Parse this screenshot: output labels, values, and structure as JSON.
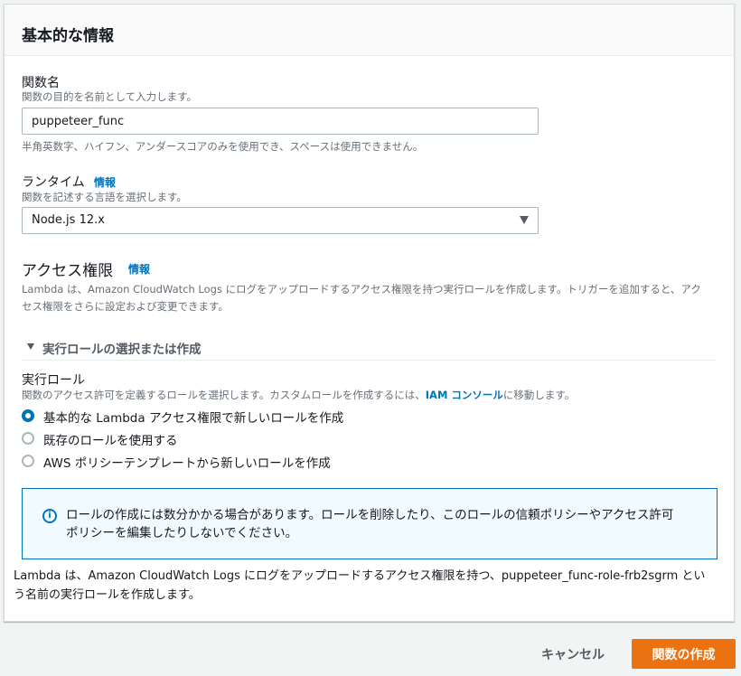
{
  "panel": {
    "title": "基本的な情報"
  },
  "function_name": {
    "label": "関数名",
    "description": "関数の目的を名前として入力します。",
    "value": "puppeteer_func",
    "hint": "半角英数字、ハイフン、アンダースコアのみを使用でき、スペースは使用できません。"
  },
  "runtime": {
    "label": "ランタイム",
    "info": "情報",
    "description": "関数を記述する言語を選択します。",
    "selected": "Node.js 12.x"
  },
  "permissions": {
    "title": "アクセス権限",
    "info": "情報",
    "description_line1": "Lambda は、Amazon CloudWatch Logs にログをアップロードするアクセス権限を持つ実行ロールを作成します。トリガーを追加すると、アク",
    "description_line2": "セス権限をさらに設定および変更できます。",
    "expander_label": "実行ロールの選択または作成"
  },
  "execution_role": {
    "label": "実行ロール",
    "description_before": "関数のアクセス許可を定義するロールを選択します。カスタムロールを作成するには、",
    "iam_link": "IAM コンソール",
    "description_after": "に移動します。",
    "options": [
      {
        "label": "基本的な Lambda アクセス権限で新しいロールを作成",
        "checked": true
      },
      {
        "label": "既存のロールを使用する",
        "checked": false
      },
      {
        "label": "AWS ポリシーテンプレートから新しいロールを作成",
        "checked": false
      }
    ]
  },
  "alert": {
    "icon": "info-icon",
    "text_line1": "ロールの作成には数分かかる場合があります。ロールを削除したり、このロールの信頼ポリシーやアクセス許可",
    "text_line2": "ポリシーを編集したりしないでください。"
  },
  "footer_note": {
    "line1": "Lambda は、Amazon CloudWatch Logs にログをアップロードするアクセス権限を持つ、puppeteer_func-role-frb2sgrm とい",
    "line2": "う名前の実行ロールを作成します。"
  },
  "actions": {
    "cancel": "キャンセル",
    "create": "関数の作成"
  },
  "colors": {
    "primary_button": "#ec7211",
    "link": "#0073bb",
    "alert_bg": "#f1faff"
  }
}
